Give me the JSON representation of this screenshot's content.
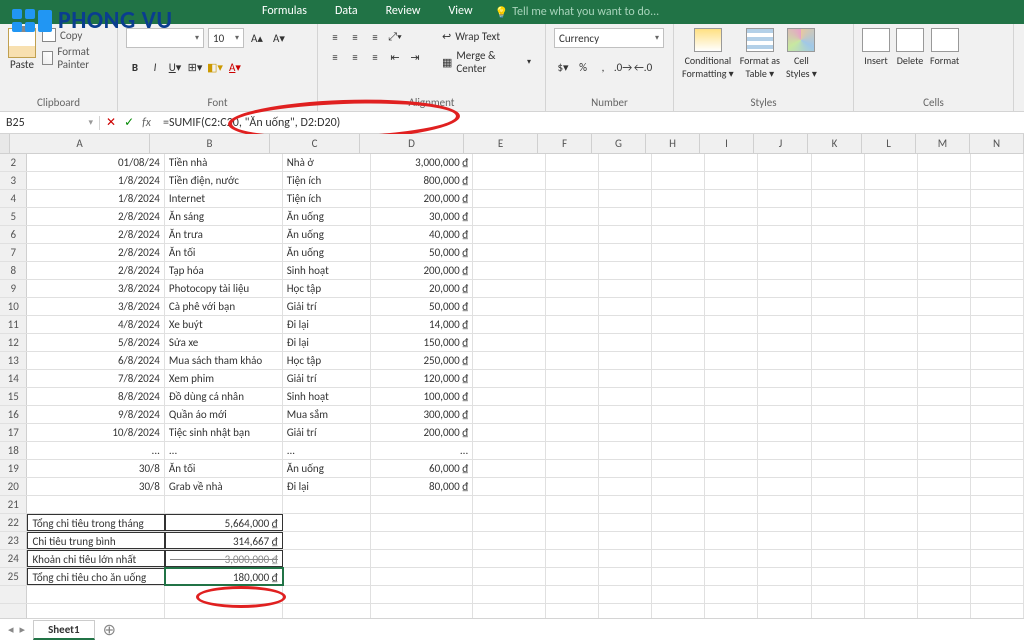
{
  "logo": {
    "text": "PHONG VU"
  },
  "tabs": {
    "items": [
      "Formulas",
      "Data",
      "Review",
      "View"
    ],
    "tellme": "Tell me what you want to do..."
  },
  "ribbon": {
    "clipboard": {
      "label": "Clipboard",
      "paste": "Paste",
      "copy": "Copy",
      "format_painter": "Format Painter"
    },
    "font": {
      "label": "Font",
      "name": "",
      "size": "10"
    },
    "alignment": {
      "label": "Alignment",
      "wrap": "Wrap Text",
      "merge": "Merge & Center"
    },
    "number": {
      "label": "Number",
      "format": "Currency"
    },
    "styles": {
      "label": "Styles",
      "conditional": "Conditional\nFormatting ▾",
      "table": "Format as\nTable ▾",
      "cell": "Cell\nStyles ▾"
    },
    "cells": {
      "label": "Cells",
      "insert": "Insert",
      "delete": "Delete",
      "format": "Format"
    }
  },
  "formula_bar": {
    "name_box": "B25",
    "formula": "=SUMIF(C2:C20, \"Ăn uống\", D2:D20)"
  },
  "columns": [
    "A",
    "B",
    "C",
    "D",
    "E",
    "F",
    "G",
    "H",
    "I",
    "J",
    "K",
    "L",
    "M",
    "N"
  ],
  "rows": [
    {
      "n": 2,
      "a": "01/08/24",
      "b": "Tiền nhà",
      "c": "Nhà ở",
      "d": "3,000,000 ₫"
    },
    {
      "n": 3,
      "a": "1/8/2024",
      "b": "Tiền điện, nước",
      "c": "Tiện ích",
      "d": "800,000 ₫"
    },
    {
      "n": 4,
      "a": "1/8/2024",
      "b": "Internet",
      "c": "Tiện ích",
      "d": "200,000 ₫"
    },
    {
      "n": 5,
      "a": "2/8/2024",
      "b": "Ăn sáng",
      "c": "Ăn uống",
      "d": "30,000 ₫"
    },
    {
      "n": 6,
      "a": "2/8/2024",
      "b": "Ăn trưa",
      "c": "Ăn uống",
      "d": "40,000 ₫"
    },
    {
      "n": 7,
      "a": "2/8/2024",
      "b": "Ăn tối",
      "c": "Ăn uống",
      "d": "50,000 ₫"
    },
    {
      "n": 8,
      "a": "2/8/2024",
      "b": "Tạp hóa",
      "c": "Sinh hoạt",
      "d": "200,000 ₫"
    },
    {
      "n": 9,
      "a": "3/8/2024",
      "b": "Photocopy tài liệu",
      "c": "Học tập",
      "d": "20,000 ₫"
    },
    {
      "n": 10,
      "a": "3/8/2024",
      "b": "Cà phê với bạn",
      "c": "Giải trí",
      "d": "50,000 ₫"
    },
    {
      "n": 11,
      "a": "4/8/2024",
      "b": "Xe buýt",
      "c": "Đi lại",
      "d": "14,000 ₫"
    },
    {
      "n": 12,
      "a": "5/8/2024",
      "b": "Sửa xe",
      "c": "Đi lại",
      "d": "150,000 ₫"
    },
    {
      "n": 13,
      "a": "6/8/2024",
      "b": "Mua sách tham khảo",
      "c": "Học tập",
      "d": "250,000 ₫"
    },
    {
      "n": 14,
      "a": "7/8/2024",
      "b": "Xem phim",
      "c": "Giải trí",
      "d": "120,000 ₫"
    },
    {
      "n": 15,
      "a": "8/8/2024",
      "b": "Đồ dùng cá nhân",
      "c": "Sinh hoạt",
      "d": "100,000 ₫"
    },
    {
      "n": 16,
      "a": "9/8/2024",
      "b": "Quần áo mới",
      "c": "Mua sắm",
      "d": "300,000 ₫"
    },
    {
      "n": 17,
      "a": "10/8/2024",
      "b": "Tiệc sinh nhật bạn",
      "c": "Giải trí",
      "d": "200,000 ₫"
    },
    {
      "n": 18,
      "a": "...",
      "b": "...",
      "c": "...",
      "d": "..."
    },
    {
      "n": 19,
      "a": "30/8",
      "b": "Ăn tối",
      "c": "Ăn uống",
      "d": "60,000 ₫"
    },
    {
      "n": 20,
      "a": "30/8",
      "b": "Grab về nhà",
      "c": "Đi lại",
      "d": "80,000 ₫"
    },
    {
      "n": 21,
      "a": "",
      "b": "",
      "c": "",
      "d": ""
    },
    {
      "n": 22,
      "a": "Tổng chi tiêu trong tháng",
      "b": "5,664,000 ₫",
      "c": "",
      "d": ""
    },
    {
      "n": 23,
      "a": "Chi tiêu trung bình",
      "b": "314,667 ₫",
      "c": "",
      "d": ""
    },
    {
      "n": 24,
      "a": "Khoản chi tiêu lớn nhất",
      "b": "3,000,000 ₫",
      "c": "",
      "d": ""
    },
    {
      "n": 25,
      "a": "Tổng chi tiêu cho ăn uống",
      "b": "180,000 ₫",
      "c": "",
      "d": ""
    }
  ],
  "sheet": {
    "name": "Sheet1"
  }
}
